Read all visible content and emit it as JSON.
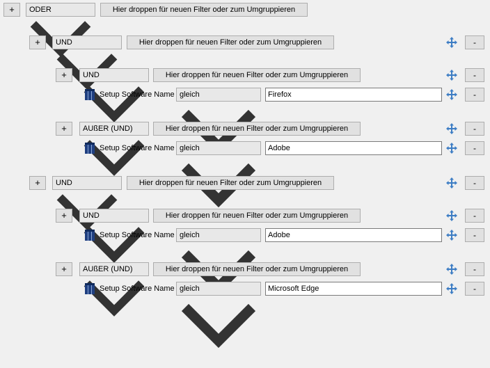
{
  "icons": {
    "add": "plus",
    "remove": "minus",
    "move": "move-arrows-icon",
    "field": "table-icon",
    "dropdown": "chevron-down-icon"
  },
  "colors": {
    "accent": "#3d7dc4",
    "field_icon": "#1f3f80"
  },
  "root": {
    "add_label": "+",
    "operator": "ODER",
    "drop_label": "Hier droppen für neuen Filter oder zum Umgruppieren"
  },
  "groups": [
    {
      "add_label": "+",
      "operator": "UND",
      "drop_label": "Hier droppen für neuen Filter oder zum Umgruppieren",
      "remove_label": "-",
      "subgroups": [
        {
          "add_label": "+",
          "operator": "UND",
          "drop_label": "Hier droppen für neuen Filter oder zum Umgruppieren",
          "remove_label": "-",
          "condition": {
            "field": "Setup Software Name",
            "comparator": "gleich",
            "value": "Firefox",
            "remove_label": "-"
          }
        },
        {
          "add_label": "+",
          "operator": "AUßER (UND)",
          "drop_label": "Hier droppen für neuen Filter oder zum Umgruppieren",
          "remove_label": "-",
          "condition": {
            "field": "Setup Software Name",
            "comparator": "gleich",
            "value": "Adobe",
            "remove_label": "-"
          }
        }
      ]
    },
    {
      "add_label": "+",
      "operator": "UND",
      "drop_label": "Hier droppen für neuen Filter oder zum Umgruppieren",
      "remove_label": "-",
      "subgroups": [
        {
          "add_label": "+",
          "operator": "UND",
          "drop_label": "Hier droppen für neuen Filter oder zum Umgruppieren",
          "remove_label": "-",
          "condition": {
            "field": "Setup Software Name",
            "comparator": "gleich",
            "value": "Adobe",
            "remove_label": "-"
          }
        },
        {
          "add_label": "+",
          "operator": "AUßER (UND)",
          "drop_label": "Hier droppen für neuen Filter oder zum Umgruppieren",
          "remove_label": "-",
          "condition": {
            "field": "Setup Software Name",
            "comparator": "gleich",
            "value": "Microsoft Edge",
            "remove_label": "-"
          }
        }
      ]
    }
  ]
}
